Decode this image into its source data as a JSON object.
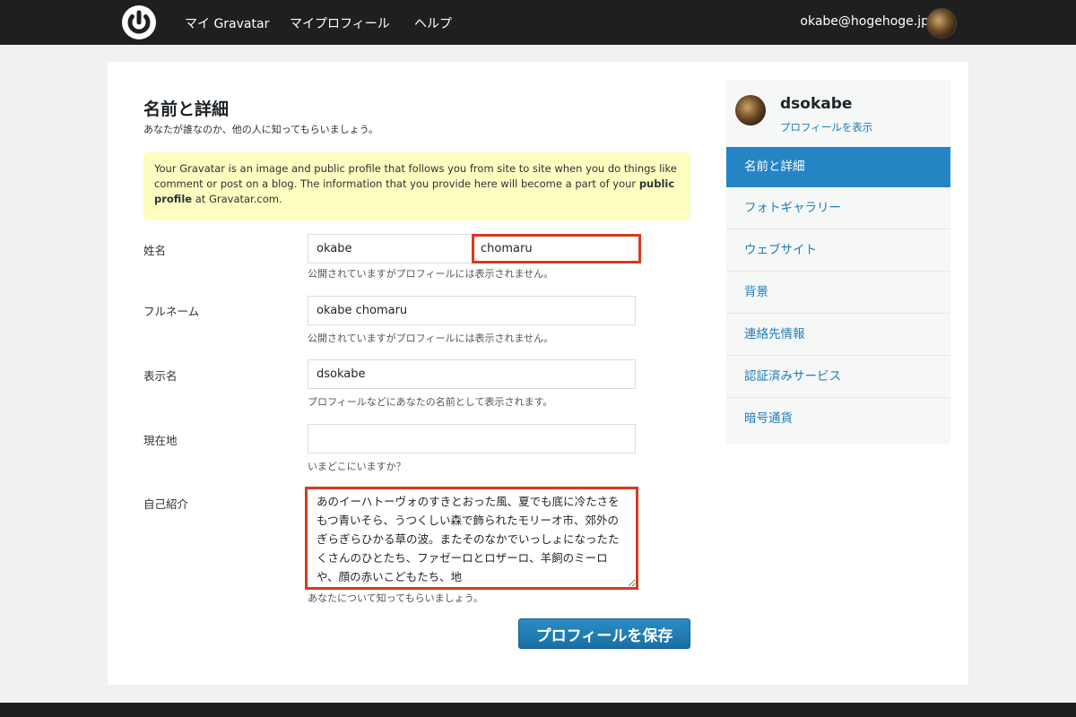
{
  "topbar": {
    "nav": [
      "マイ Gravatar",
      "マイプロフィール",
      "ヘルプ"
    ],
    "user_email": "okabe@hogehoge.jp"
  },
  "main": {
    "title": "名前と詳細",
    "subtitle": "あなたが誰なのか、他の人に知ってもらいましょう。",
    "notice_text": "Your Gravatar is an image and public profile that follows you from site to site when you do things like comment or post on a blog. The information that you provide here will become a part of your ",
    "notice_bold": "public profile",
    "notice_tail": " at Gravatar.com.",
    "fields": {
      "name": {
        "label": "姓名",
        "first": "okabe",
        "last": "chomaru",
        "hint": "公開されていますがプロフィールには表示されません。"
      },
      "fullname": {
        "label": "フルネーム",
        "value": "okabe chomaru",
        "hint": "公開されていますがプロフィールには表示されません。"
      },
      "display": {
        "label": "表示名",
        "value": "dsokabe",
        "hint": "プロフィールなどにあなたの名前として表示されます。"
      },
      "location": {
        "label": "現在地",
        "value": "",
        "hint": "いまどこにいますか？"
      },
      "bio": {
        "label": "自己紹介",
        "value": "あのイーハトーヴォのすきとおった風、夏でも底に冷たさをもつ青いそら、うつくしい森で飾られたモリーオ市、郊外のぎらぎらひかる草の波。またそのなかでいっしょになったたくさんのひとたち、ファゼーロとロザーロ、羊飼のミーロや、顔の赤いこどもたち、地",
        "hint": "あなたについて知ってもらいましょう。"
      }
    },
    "save_label": "プロフィールを保存"
  },
  "sidebar": {
    "username": "dsokabe",
    "view_profile": "プロフィールを表示",
    "items": [
      "名前と詳細",
      "フォトギャラリー",
      "ウェブサイト",
      "背景",
      "連絡先情報",
      "認証済みサービス",
      "暗号通貨"
    ],
    "active_index": 0
  },
  "colors": {
    "accent": "#2585c4",
    "link": "#1e7db8",
    "highlight": "#d63b1e",
    "notice_bg": "#fdfdbf",
    "topbar": "#1f1f1f"
  }
}
